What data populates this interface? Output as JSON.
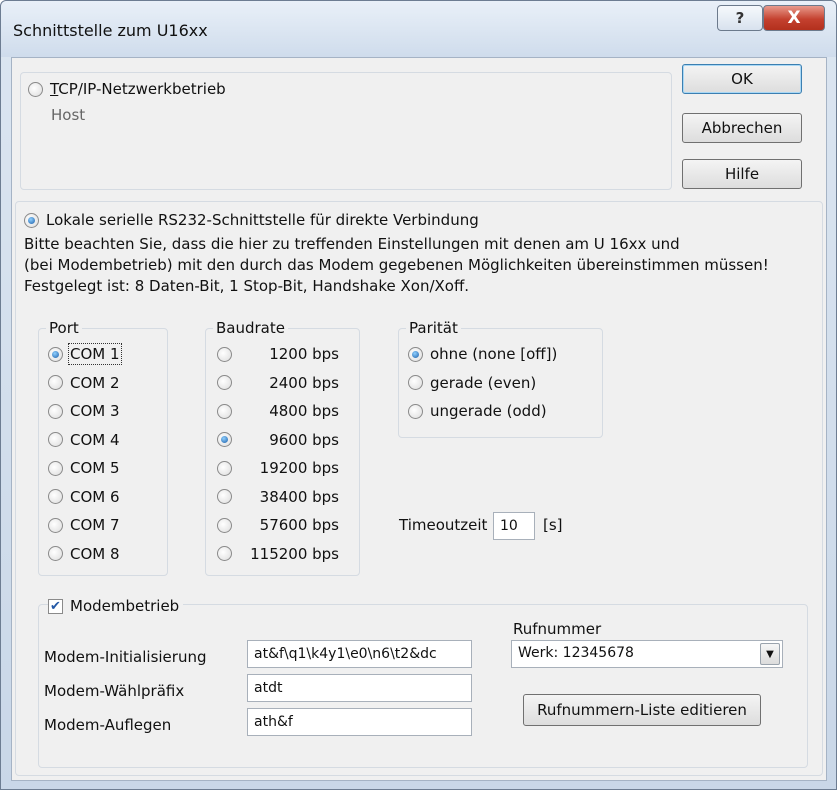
{
  "window": {
    "title": "Schnittstelle zum U16xx",
    "help_glyph": "?",
    "close_glyph": "X"
  },
  "buttons": {
    "ok": "OK",
    "cancel": "Abbrechen",
    "help": "Hilfe",
    "number_list": "Rufnummern-Liste editieren"
  },
  "tcp": {
    "radio_label": "TCP/IP-Netzwerkbetrieb",
    "selected": false,
    "host_label": "Host"
  },
  "serial": {
    "radio_label": "Lokale serielle RS232-Schnittstelle für direkte Verbindung",
    "selected": true,
    "info_line1": "Bitte beachten Sie, dass die hier zu treffenden Einstellungen mit denen am U 16xx und",
    "info_line2": "(bei Modembetrieb) mit den durch das Modem gegebenen Möglichkeiten übereinstimmen müssen!",
    "info_line3": "Festgelegt ist: 8 Daten-Bit, 1 Stop-Bit, Handshake Xon/Xoff."
  },
  "port": {
    "legend": "Port",
    "options": [
      "COM 1",
      "COM 2",
      "COM 3",
      "COM 4",
      "COM 5",
      "COM 6",
      "COM 7",
      "COM 8"
    ],
    "selected": "COM 1"
  },
  "baudrate": {
    "legend": "Baudrate",
    "options": [
      "1200 bps",
      "2400 bps",
      "4800 bps",
      "9600 bps",
      "19200 bps",
      "38400 bps",
      "57600 bps",
      "115200 bps"
    ],
    "selected": "9600 bps"
  },
  "parity": {
    "legend": "Parität",
    "options": [
      "ohne (none [off])",
      "gerade (even)",
      "ungerade (odd)"
    ],
    "selected": "ohne (none [off])"
  },
  "timeout": {
    "label": "Timeoutzeit",
    "value": "10",
    "unit": "[s]"
  },
  "modem": {
    "checkbox_label": "Modembetrieb",
    "checked": true,
    "init_label": "Modem-Initialisierung",
    "init_value": "at&f\\q1\\k4y1\\e0\\n6\\t2&dc",
    "dial_label": "Modem-Wählpräfix",
    "dial_value": "atdt",
    "hangup_label": "Modem-Auflegen",
    "hangup_value": "ath&f",
    "number_label": "Rufnummer",
    "number_value": "Werk: 12345678"
  }
}
